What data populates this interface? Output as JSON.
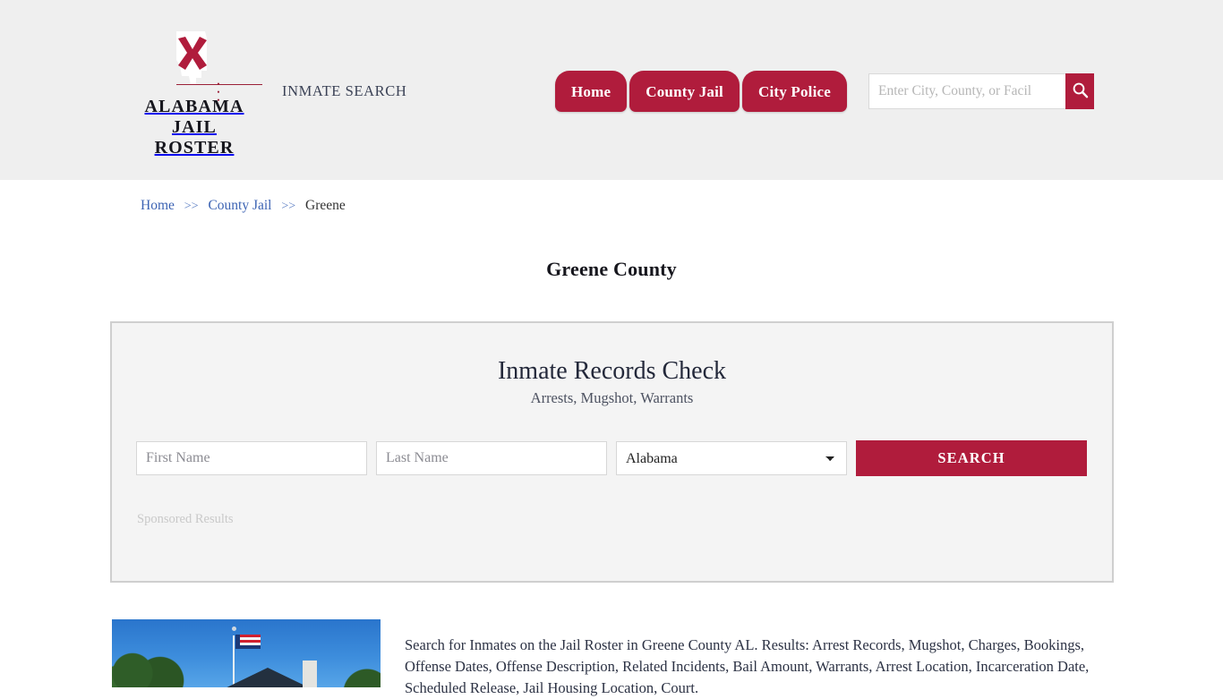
{
  "header": {
    "brand": {
      "line1": "ALABAMA",
      "line2": "JAIL ROSTER",
      "dots": "• • •",
      "logo_icon": "alabama-state-outline-with-red-cross"
    },
    "tagline": "INMATE SEARCH",
    "nav": [
      {
        "label": "Home"
      },
      {
        "label": "County Jail"
      },
      {
        "label": "City Police"
      }
    ],
    "search": {
      "placeholder": "Enter City, County, or Facil",
      "value": "",
      "button_icon": "search-icon"
    }
  },
  "breadcrumb": {
    "items": [
      {
        "label": "Home",
        "link": true
      },
      {
        "label": "County Jail",
        "link": true
      },
      {
        "label": "Greene",
        "link": false
      }
    ],
    "separator": ">>"
  },
  "page": {
    "title": "Greene County"
  },
  "sponsor_panel": {
    "title": "Inmate Records Check",
    "subtitle": "Arrests, Mugshot, Warrants",
    "form": {
      "first_name_placeholder": "First Name",
      "first_name_value": "",
      "last_name_placeholder": "Last Name",
      "last_name_value": "",
      "state_selected": "Alabama",
      "state_options": [
        "Alabama"
      ],
      "submit_label": "SEARCH"
    },
    "note": "Sponsored Results"
  },
  "content": {
    "photo_alt": "county-courthouse-with-american-flag",
    "description": "Search for Inmates on the Jail Roster in Greene County AL. Results: Arrest Records, Mugshot, Charges, Bookings, Offense Dates, Offense Description, Related Incidents, Bail Amount, Warrants, Arrest Location, Incarceration Date, Scheduled Release, Jail Housing Location, Court."
  },
  "colors": {
    "accent": "#b01c3c",
    "header_bg": "#efefef",
    "panel_bg": "#f4f4f4",
    "panel_border": "#cfcfcf",
    "link": "#3c63b3"
  }
}
